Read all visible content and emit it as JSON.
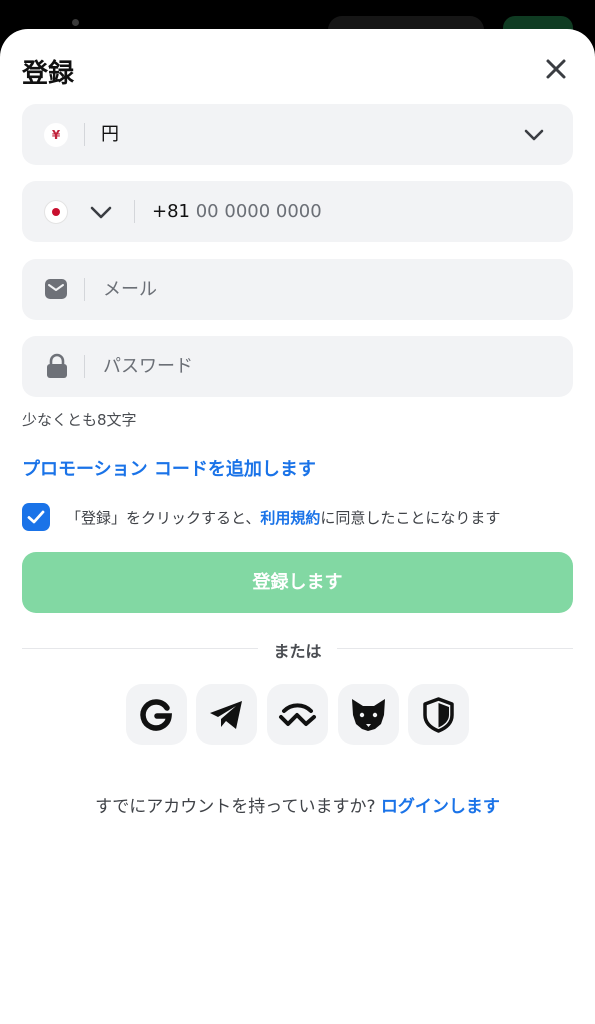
{
  "dialog": {
    "title": "登録",
    "close_icon": "close-icon"
  },
  "currency": {
    "symbol": "¥",
    "value": "円",
    "icon": "chevron-down-icon"
  },
  "phone": {
    "country_flag": "japan-flag-icon",
    "prefix": "+81",
    "placeholder": "00 0000 0000"
  },
  "email": {
    "icon": "mail-icon",
    "placeholder": "メール"
  },
  "password": {
    "icon": "lock-icon",
    "placeholder": "パスワード",
    "hint": "少なくとも8文字"
  },
  "promo": {
    "label": "プロモーション コードを追加します"
  },
  "terms": {
    "checked": true,
    "prefix": "「登録」をクリックすると、",
    "link": "利用規約",
    "suffix": "に同意したことになります"
  },
  "submit": {
    "label": "登録します",
    "color": "#82d8a3"
  },
  "divider": {
    "label": "または"
  },
  "social": [
    {
      "icon": "google-icon"
    },
    {
      "icon": "telegram-icon"
    },
    {
      "icon": "walletconnect-icon"
    },
    {
      "icon": "metamask-fox-icon"
    },
    {
      "icon": "shield-icon"
    }
  ],
  "footer": {
    "question": "すでにアカウントを持っていますか?",
    "login_link": "ログインします"
  },
  "colors": {
    "accent": "#1a73e8",
    "field_bg": "#f2f3f5"
  }
}
